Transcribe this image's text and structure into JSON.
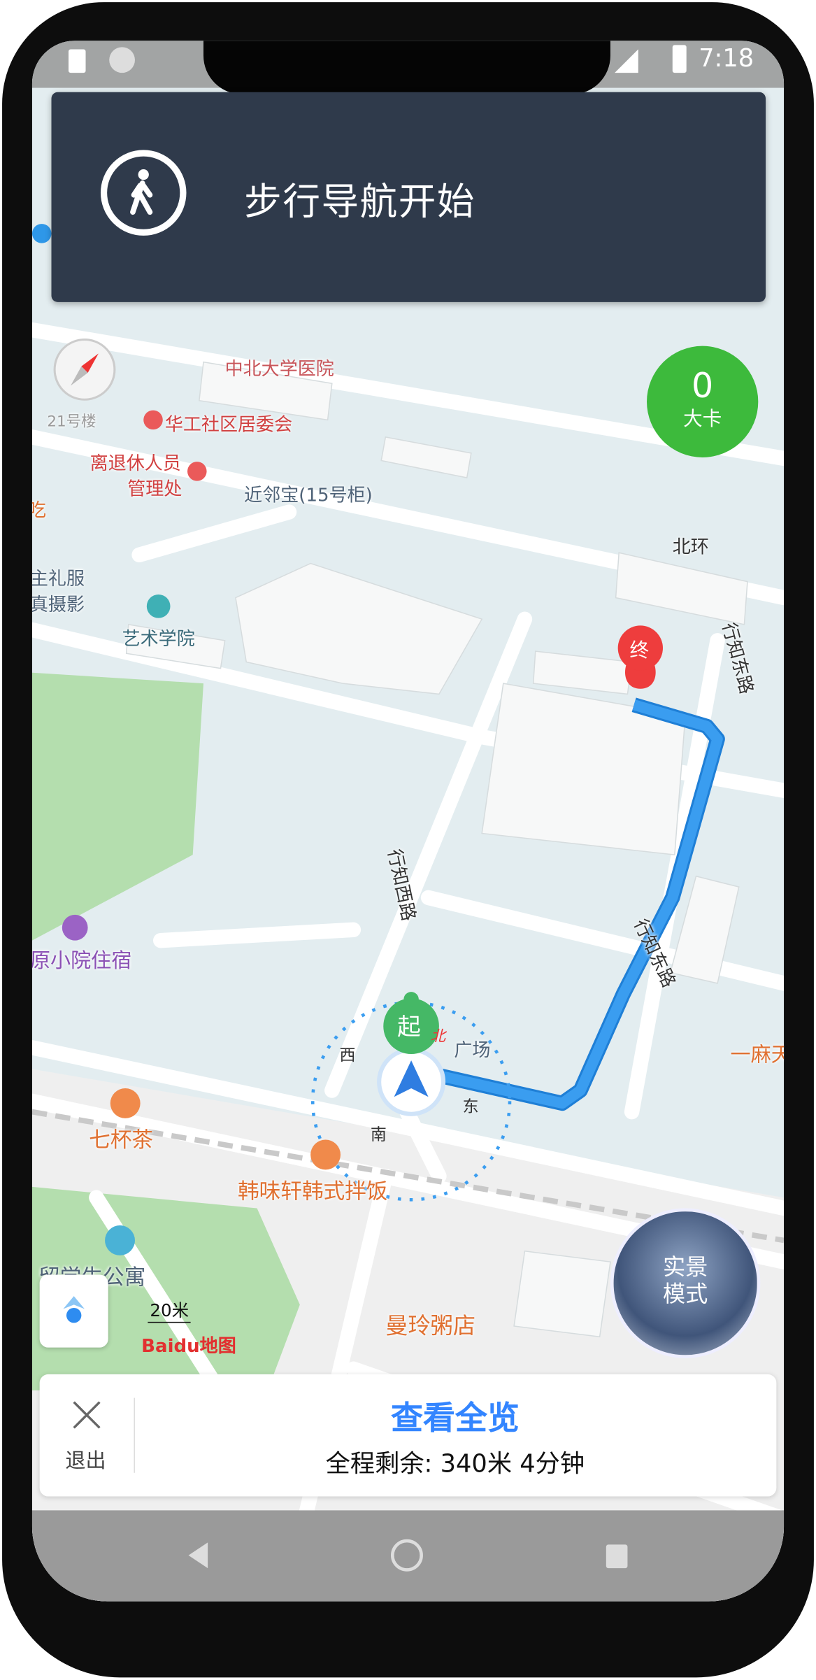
{
  "status_bar": {
    "time": "7:18",
    "icons": [
      "sim-icon",
      "sync-icon",
      "no-signal-icon",
      "cell-signal-icon",
      "battery-icon"
    ]
  },
  "banner": {
    "icon": "pedestrian-icon",
    "text": "步行导航开始"
  },
  "calories": {
    "value": "0",
    "unit": "大卡",
    "color": "#3dba3c"
  },
  "compass": {
    "icon": "compass-icon",
    "label": "21号楼"
  },
  "map_labels": {
    "hospital": "中北大学医院",
    "committee": "华工社区居委会",
    "retire_1": "离退休人员",
    "retire_2": "管理处",
    "locker": "近邻宝(15号柜)",
    "beihuan": "北环",
    "east_road_top": "行知东路",
    "photo_1": "主礼服",
    "photo_2": "真摄影",
    "eat": "吃",
    "art": "艺术学院",
    "west_road": "行知西路",
    "east_road": "行知东路",
    "inn": "原小院住宿",
    "plaza": "广场",
    "noodle": "一麻天",
    "tea": "七杯茶",
    "korean": "韩味轩韩式拌饭",
    "dorm": "留学生公寓",
    "porridge": "曼玲粥店"
  },
  "markers": {
    "start": "起",
    "end": "终",
    "north": "北",
    "west": "西",
    "south": "南",
    "east": "东"
  },
  "route_color": "#3a9df0",
  "scale": {
    "label": "20米"
  },
  "logo": {
    "text": "Baidu地图"
  },
  "live_view": {
    "line1": "实景",
    "line2": "模式"
  },
  "bottom_card": {
    "exit_label": "退出",
    "overview_label": "查看全览",
    "remaining": "全程剩余: 340米 4分钟",
    "accent": "#3385ff"
  },
  "nav_bar": {
    "back": "back-icon",
    "home": "home-icon",
    "recents": "recents-icon"
  }
}
